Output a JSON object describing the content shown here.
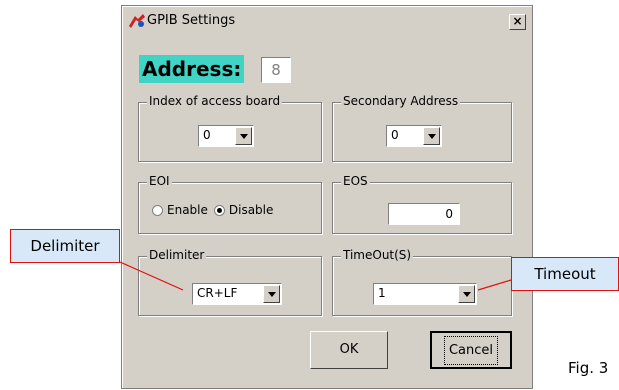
{
  "window": {
    "title": "GPIB Settings",
    "close_label": "×"
  },
  "address": {
    "label": "Address:",
    "value": "8"
  },
  "groups": {
    "board": {
      "label": "Index of access board",
      "value": "0"
    },
    "secondary": {
      "label": "Secondary Address",
      "value": "0"
    },
    "eoi": {
      "label": "EOI",
      "enable": "Enable",
      "disable": "Disable",
      "selected": "Disable"
    },
    "eos": {
      "label": "EOS",
      "value": "0"
    },
    "delimiter": {
      "label": "Delimiter",
      "value": "CR+LF"
    },
    "timeout": {
      "label": "TimeOut(S)",
      "value": "1"
    }
  },
  "buttons": {
    "ok": "OK",
    "cancel": "Cancel"
  },
  "callouts": {
    "delimiter": "Delimiter",
    "timeout": "Timeout"
  },
  "caption": "Fig. 3",
  "colors": {
    "address_highlight": "#3fd4c4",
    "callout_fill": "#d8e8f8",
    "callout_border": "#e01010"
  }
}
